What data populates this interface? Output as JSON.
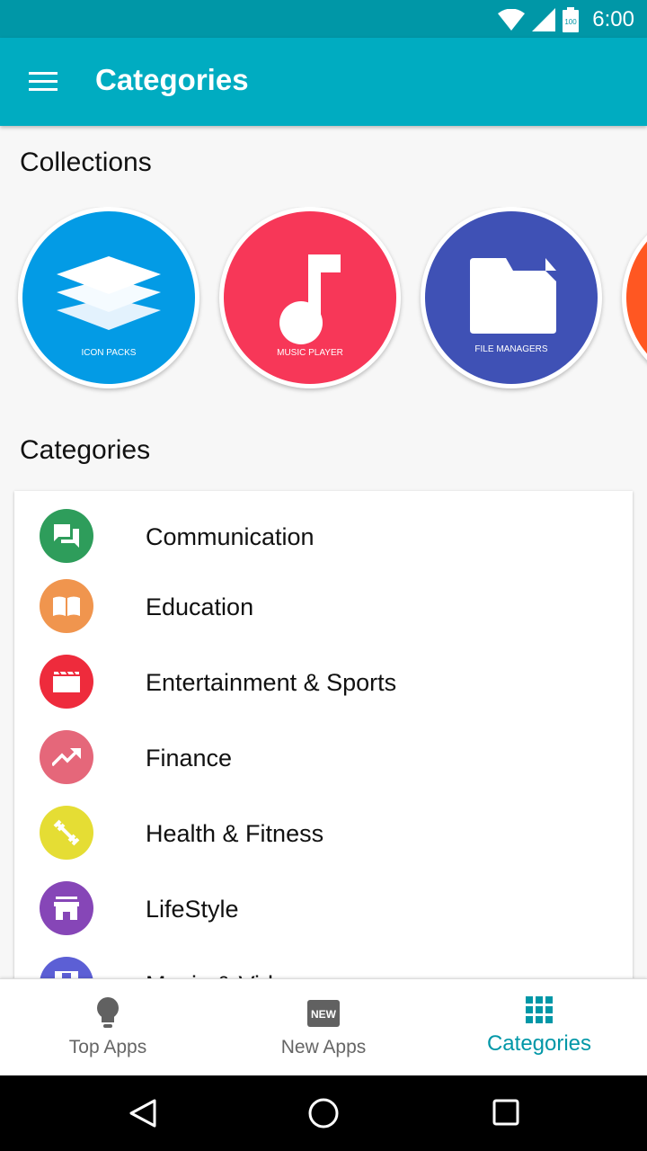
{
  "status_bar": {
    "time": "6:00",
    "battery_level": "100"
  },
  "app_bar": {
    "title": "Categories",
    "menu_icon": "menu-icon"
  },
  "collections": {
    "heading": "Collections",
    "items": [
      {
        "label": "ICON PACKS",
        "color": "#039be5",
        "icon": "layers-icon"
      },
      {
        "label": "MUSIC PLAYER",
        "color": "#f73758",
        "icon": "music-note-icon"
      },
      {
        "label": "FILE MANAGERS",
        "color": "#3f51b5",
        "icon": "folder-icon"
      },
      {
        "label": "",
        "color": "#ff5722",
        "icon": ""
      }
    ]
  },
  "categories": {
    "heading": "Categories",
    "items": [
      {
        "label": "Communication",
        "color": "#2e9d5b",
        "icon": "chat-icon"
      },
      {
        "label": "Education",
        "color": "#f0954e",
        "icon": "book-icon"
      },
      {
        "label": "Entertainment & Sports",
        "color": "#ee2b3c",
        "icon": "movie-icon"
      },
      {
        "label": "Finance",
        "color": "#e5677a",
        "icon": "trending-up-icon"
      },
      {
        "label": "Health & Fitness",
        "color": "#e5dd34",
        "icon": "fitness-icon"
      },
      {
        "label": "LifeStyle",
        "color": "#8646b7",
        "icon": "store-icon"
      },
      {
        "label": "Music & Video",
        "color": "#5c5fd5",
        "icon": "film-icon"
      }
    ]
  },
  "bottom_nav": {
    "items": [
      {
        "label": "Top Apps",
        "icon": "lightbulb-icon",
        "active": false
      },
      {
        "label": "New Apps",
        "icon": "new-badge-icon",
        "badge_text": "NEW",
        "active": false
      },
      {
        "label": "Categories",
        "icon": "grid-icon",
        "active": true
      }
    ],
    "active_color": "#0097a7"
  },
  "system_nav": {
    "back": "back-icon",
    "home": "home-icon",
    "recents": "recents-icon"
  }
}
